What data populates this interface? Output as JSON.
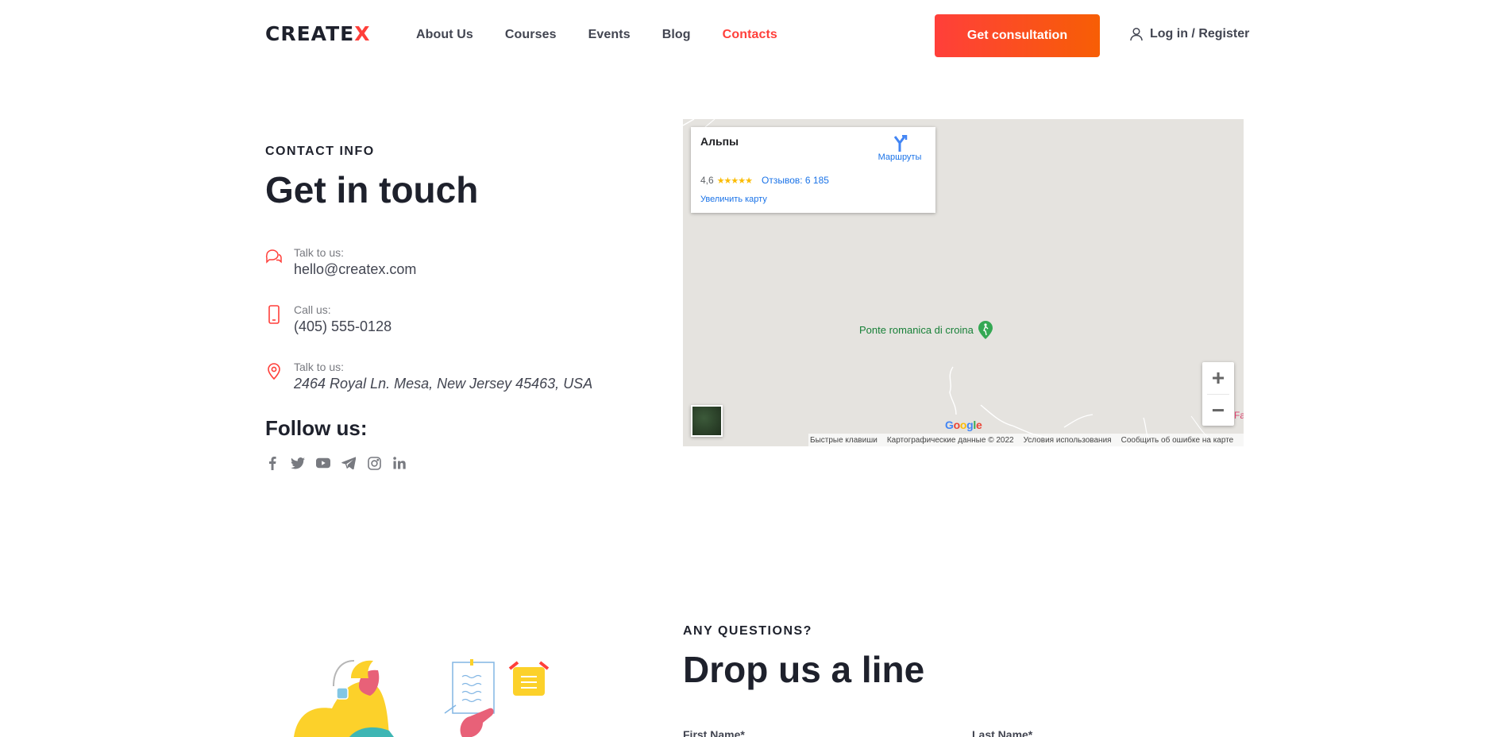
{
  "header": {
    "logo_main": "CREATE",
    "logo_accent": "X",
    "nav": [
      {
        "label": "About Us",
        "active": false
      },
      {
        "label": "Courses",
        "active": false
      },
      {
        "label": "Events",
        "active": false
      },
      {
        "label": "Blog",
        "active": false
      },
      {
        "label": "Contacts",
        "active": true
      }
    ],
    "cta_label": "Get consultation",
    "login_label": "Log in / Register"
  },
  "contact": {
    "eyebrow": "CONTACT INFO",
    "title": "Get in touch",
    "items": [
      {
        "icon": "chat-icon",
        "label": "Talk to us:",
        "value": "hello@createx.com"
      },
      {
        "icon": "phone-icon",
        "label": "Call us:",
        "value": "(405) 555-0128"
      },
      {
        "icon": "location-pin-icon",
        "label": "Talk to us:",
        "value": "2464 Royal Ln. Mesa, New Jersey 45463, USA"
      }
    ],
    "follow_title": "Follow us:",
    "socials": [
      "facebook-icon",
      "twitter-icon",
      "youtube-icon",
      "telegram-icon",
      "instagram-icon",
      "linkedin-icon"
    ]
  },
  "map": {
    "place_name": "Альпы",
    "route_label": "Маршруты",
    "rating": "4,6",
    "stars": "★★★★★",
    "reviews": "Отзывов: 6 185",
    "enlarge": "Увеличить карту",
    "poi": "Ponte romanica di croina",
    "zoom_in": "+",
    "zoom_out": "−",
    "google": "Google",
    "edge_text": "Fa",
    "attribution": [
      "Быстрые клавиши",
      "Картографические данные © 2022",
      "Условия использования",
      "Сообщить об ошибке на карте"
    ]
  },
  "questions": {
    "eyebrow": "ANY QUESTIONS?",
    "title": "Drop us a line",
    "first_name_label": "First Name*",
    "last_name_label": "Last Name*"
  },
  "colors": {
    "accent": "#ff3f3a",
    "accent_end": "#f75e05",
    "dark": "#1e212c",
    "text": "#424551",
    "muted": "#787a80"
  }
}
